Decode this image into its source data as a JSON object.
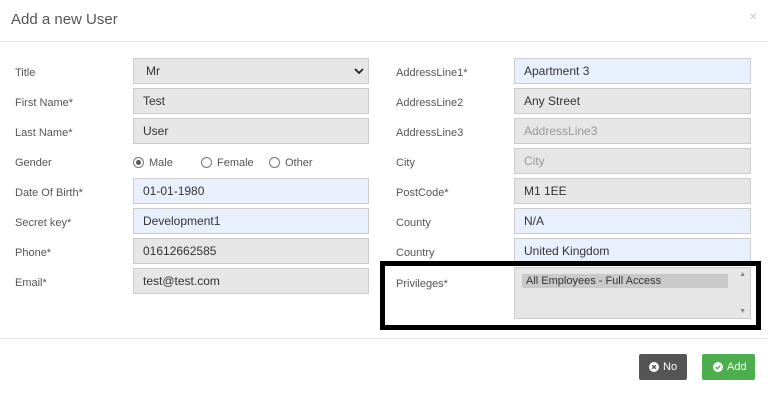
{
  "modal": {
    "title": "Add a new User",
    "close_glyph": "×"
  },
  "form_left": {
    "title": {
      "label": "Title",
      "value": "Mr"
    },
    "first_name": {
      "label": "First Name*",
      "value": "Test"
    },
    "last_name": {
      "label": "Last Name*",
      "value": "User"
    },
    "gender": {
      "label": "Gender",
      "options": [
        "Male",
        "Female",
        "Other"
      ],
      "selected": "Male"
    },
    "dob": {
      "label": "Date Of Birth*",
      "value": "01-01-1980"
    },
    "secret_key": {
      "label": "Secret key*",
      "value": "Development1"
    },
    "phone": {
      "label": "Phone*",
      "value": "01612662585"
    },
    "email": {
      "label": "Email*",
      "value": "test@test.com"
    }
  },
  "form_right": {
    "address1": {
      "label": "AddressLine1*",
      "value": "Apartment 3"
    },
    "address2": {
      "label": "AddressLine2",
      "value": "Any Street"
    },
    "address3": {
      "label": "AddressLine3",
      "placeholder": "AddressLine3"
    },
    "city": {
      "label": "City",
      "placeholder": "City"
    },
    "postcode": {
      "label": "PostCode*",
      "value": "M1 1EE"
    },
    "county": {
      "label": "County",
      "value": "N/A"
    },
    "country": {
      "label": "Country",
      "value": "United Kingdom"
    },
    "privileges": {
      "label": "Privileges*",
      "options": [
        "All Employees - Full Access"
      ]
    }
  },
  "footer": {
    "no_label": "No",
    "add_label": "Add"
  },
  "icons": {
    "close": "close-icon",
    "select_arrow": "chevron-down-icon",
    "no": "times-circle-icon",
    "add": "check-circle-icon"
  },
  "colors": {
    "add_button": "#4cae4c",
    "no_button": "#555555",
    "highlight_border": "#000000",
    "autofill_field": "#e8f0fe",
    "disabled_field": "#e6e6e6"
  }
}
